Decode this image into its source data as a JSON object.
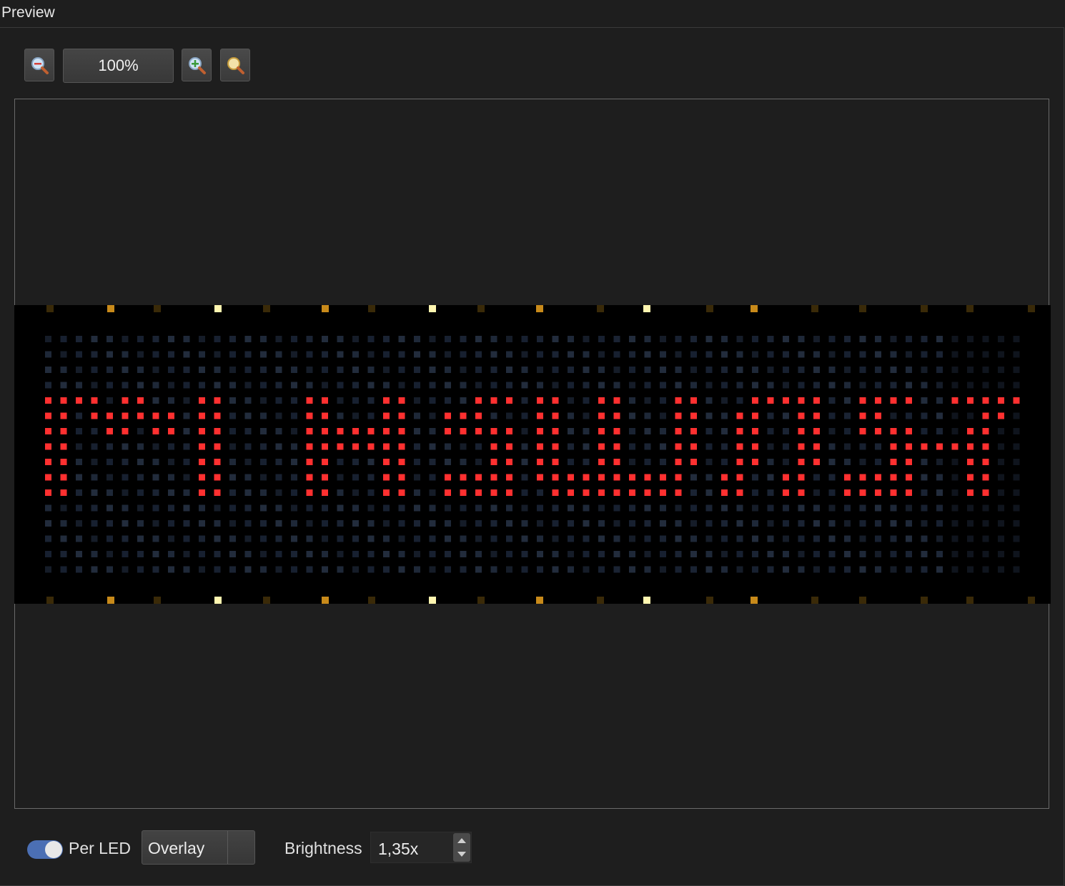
{
  "panel": {
    "title": "Preview"
  },
  "toolbar": {
    "zoom_value": "100%",
    "buttons": [
      "zoom-out-icon",
      "zoom-in-icon",
      "zoom-fit-icon"
    ]
  },
  "led_preview": {
    "grid_columns": 64,
    "grid_rows": 16,
    "text_color": "#ff3030",
    "dim_color": "#1a2333",
    "lit_rows": [
      "111101100011000001100011000011101100110001100011111001111001111100",
      "110111111011000001100011001110001100110001100110011001100000011000",
      "110011011011000001111111001111101100110001100110011001111000110000",
      "110000000011000001111111000001101100110001100110011000011111110000",
      "110000000011000001100011000001101100110001100110011000011000110000",
      "110000000011000001100011001111101111111111001100110011111000110000",
      "110000000011000001100011001111100111111111001100110011111000110000"
    ],
    "marker_colors": {
      "bright": "#fff6b0",
      "amber": "#c88a1a",
      "dark": "#3a2a08"
    }
  },
  "bottom": {
    "per_led_label": "Per LED",
    "per_led_enabled": true,
    "mode": "Overlay",
    "brightness_label": "Brightness",
    "brightness_value": "1,35x"
  }
}
